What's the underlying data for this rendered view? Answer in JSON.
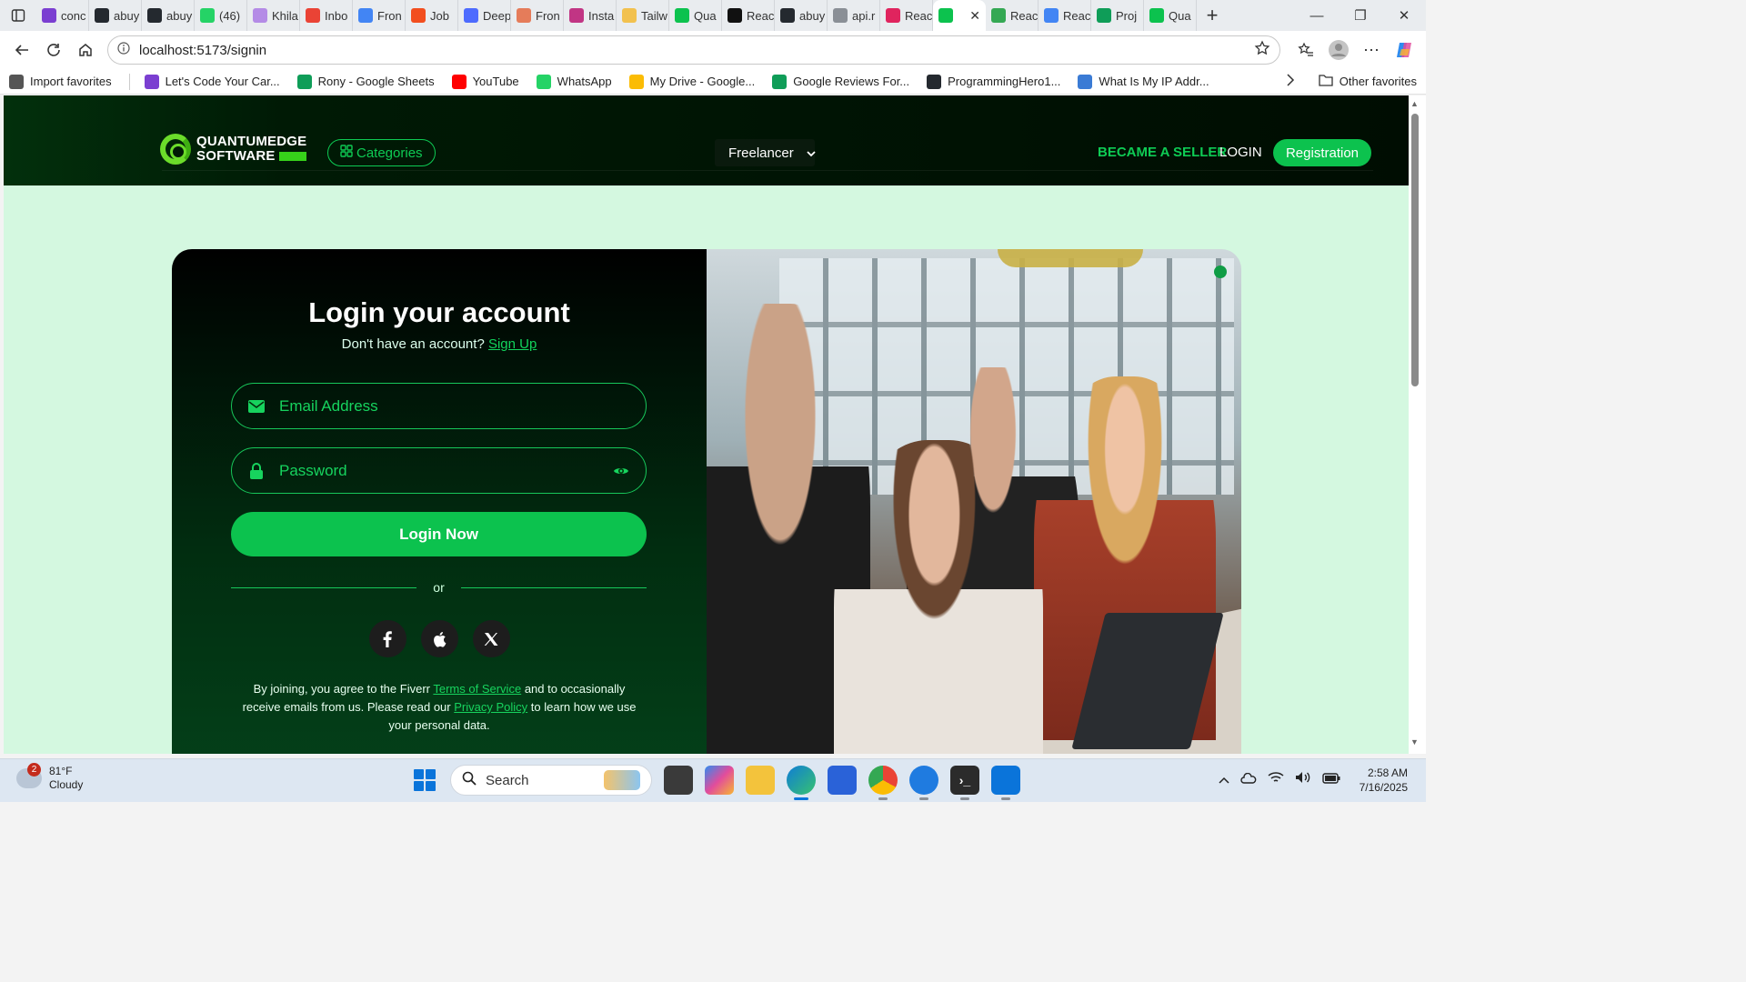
{
  "browser": {
    "tabs": [
      {
        "label": "conc",
        "color": "#7b3fd1"
      },
      {
        "label": "abuy",
        "color": "#24292f"
      },
      {
        "label": "abuy",
        "color": "#24292f"
      },
      {
        "label": "(46)",
        "color": "#25d366"
      },
      {
        "label": "Khila",
        "color": "#b48be6"
      },
      {
        "label": "Inbo",
        "color": "#ea4335"
      },
      {
        "label": "Fron",
        "color": "#4285f4"
      },
      {
        "label": "Job",
        "color": "#f24e1e"
      },
      {
        "label": "Deep",
        "color": "#4d6bfe"
      },
      {
        "label": "Fron",
        "color": "#e57c5a"
      },
      {
        "label": "Insta",
        "color": "#c13584"
      },
      {
        "label": "Tailw",
        "color": "#f2c14e"
      },
      {
        "label": "Qua",
        "color": "#0cc24e"
      },
      {
        "label": "Reac",
        "color": "#111111"
      },
      {
        "label": "abuy",
        "color": "#24292f"
      },
      {
        "label": "api.r",
        "color": "#8a8f96"
      },
      {
        "label": "Reac",
        "color": "#e0245e"
      },
      {
        "label": "",
        "color": "#0cc24e",
        "active": true
      },
      {
        "label": "Reac",
        "color": "#34a853"
      },
      {
        "label": "Reac",
        "color": "#4285f4"
      },
      {
        "label": "Proj",
        "color": "#0f9d58"
      },
      {
        "label": "Qua",
        "color": "#0cc24e"
      }
    ],
    "url": "localhost:5173/signin",
    "favorites": [
      {
        "label": "Import favorites",
        "color": "#555555"
      },
      {
        "label": "Let's Code Your Car...",
        "color": "#7b3fd1"
      },
      {
        "label": "Rony - Google Sheets",
        "color": "#0f9d58"
      },
      {
        "label": "YouTube",
        "color": "#ff0000"
      },
      {
        "label": "WhatsApp",
        "color": "#25d366"
      },
      {
        "label": "My Drive - Google...",
        "color": "#fbbc04"
      },
      {
        "label": "Google Reviews For...",
        "color": "#0f9d58"
      },
      {
        "label": "ProgrammingHero1...",
        "color": "#24292f"
      },
      {
        "label": "What Is My IP Addr...",
        "color": "#3a7bd5"
      }
    ],
    "other_favorites": "Other favorites"
  },
  "site": {
    "logo_line1": "QUANTUMEDGE",
    "logo_line2": "SOFTWARE",
    "categories_label": "Categories",
    "role_select": "Freelancer",
    "seller_label": "BECAME A SELLER",
    "login_label": "LOGIN",
    "registration_label": "Registration"
  },
  "login": {
    "title": "Login your account",
    "no_account_text": "Don't have an account?",
    "signup_link": "Sign Up",
    "email_placeholder": "Email Address",
    "password_placeholder": "Password",
    "submit_label": "Login Now",
    "divider_text": "or",
    "social": [
      "f",
      "",
      "X"
    ],
    "terms_part1": "By joining, you agree to the Fiverr",
    "terms_link": "Terms of Service",
    "terms_part2": "and to occasionally receive emails from us. Please read our",
    "privacy_link": "Privacy Policy",
    "terms_part3": "to learn how we use your personal data."
  },
  "taskbar": {
    "weather_temp": "81°F",
    "weather_desc": "Cloudy",
    "weather_badge": "2",
    "search_placeholder": "Search",
    "time": "2:58 AM",
    "date": "7/16/2025"
  }
}
